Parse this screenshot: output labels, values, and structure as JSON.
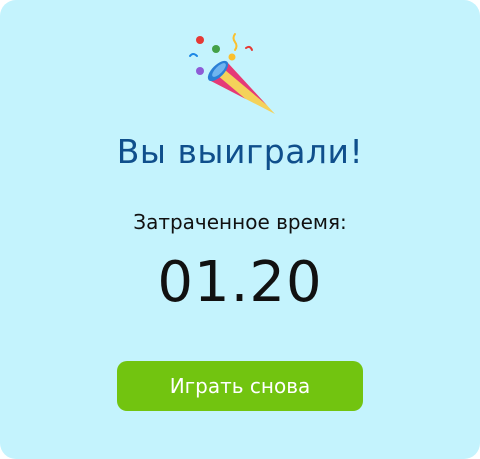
{
  "result": {
    "icon": "party-popper-icon",
    "title": "Вы выиграли!",
    "time_label": "Затраченное время:",
    "time_value": "01.20"
  },
  "actions": {
    "play_again_label": "Играть снова"
  },
  "colors": {
    "background": "#c4f3fd",
    "title": "#0f4f8c",
    "button": "#72c410",
    "button_text": "#ffffff"
  }
}
